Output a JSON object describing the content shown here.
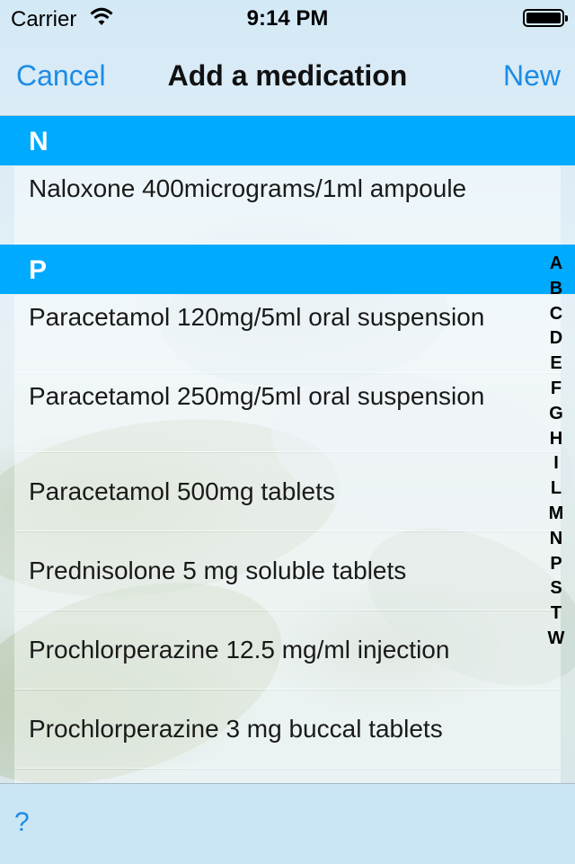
{
  "status": {
    "carrier": "Carrier",
    "time": "9:14 PM"
  },
  "nav": {
    "cancel": "Cancel",
    "title": "Add a medication",
    "new": "New"
  },
  "sections": {
    "n": {
      "letter": "N",
      "rows": [
        "Naloxone 400micrograms/1ml ampoule"
      ]
    },
    "p": {
      "letter": "P",
      "rows": [
        "Paracetamol 120mg/5ml oral suspension",
        "Paracetamol 250mg/5ml oral suspension",
        "Paracetamol 500mg tablets",
        "Prednisolone 5 mg soluble tablets",
        "Prochlorperazine 12.5 mg/ml injection",
        "Prochlorperazine 3 mg buccal tablets"
      ]
    }
  },
  "index": [
    "A",
    "B",
    "C",
    "D",
    "E",
    "F",
    "G",
    "H",
    "I",
    "L",
    "M",
    "N",
    "P",
    "S",
    "T",
    "W"
  ],
  "toolbar": {
    "help": "?"
  },
  "colors": {
    "accent": "#1c8ce6",
    "section_header": "#00aaff"
  }
}
